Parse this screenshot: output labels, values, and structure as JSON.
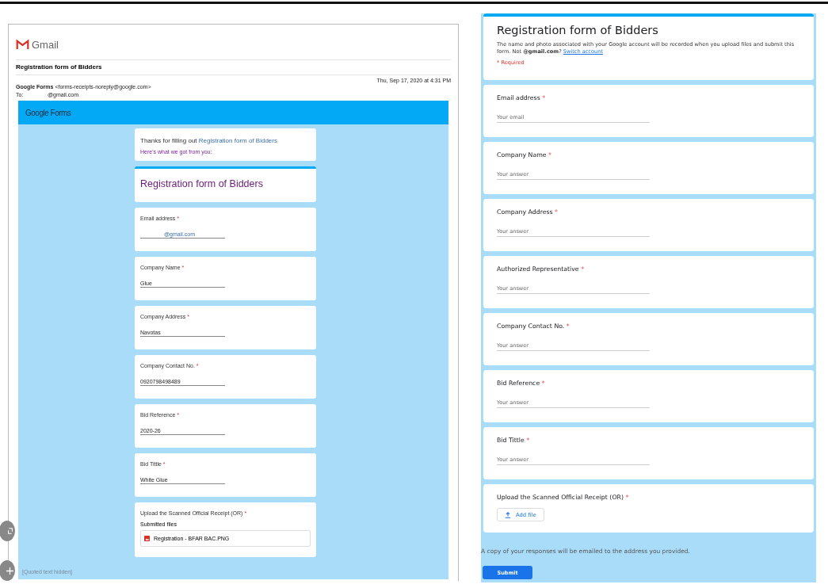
{
  "email": {
    "brand": "Gmail",
    "subject": "Registration form of Bidders",
    "sender_name": "Google Forms",
    "sender_address": "<forms-receipts-noreply@google.com>",
    "to_label": "To:",
    "to_address": "@gmail.com",
    "date": "Thu, Sep 17, 2020 at 4:31 PM",
    "banner": "Google Forms",
    "thanks_text": "Thanks for filling out",
    "thanks_link": "Registration form of Bidders",
    "thanks_sub": "Here's what we got from you:",
    "form_title": "Registration form of Bidders",
    "answers": [
      {
        "kind": "text",
        "label": "Email address",
        "asterisk": "*",
        "value": "@gmail.com"
      },
      {
        "kind": "text",
        "label": "Company Name",
        "asterisk": "*",
        "value": "Glue"
      },
      {
        "kind": "text",
        "label": "Company Address",
        "asterisk": "*",
        "value": "Navotas"
      },
      {
        "kind": "text",
        "label": "Company Contact No.",
        "asterisk": "*",
        "value": "0920798498489"
      },
      {
        "kind": "text",
        "label": "Bid Reference",
        "asterisk": "*",
        "value": "2020-26"
      },
      {
        "kind": "text",
        "label": "Bid Tittle",
        "asterisk": "*",
        "value": "White Glue"
      },
      {
        "kind": "file",
        "label": "Upload the Scanned Official Receipt (OR)",
        "asterisk": "*",
        "files_label": "Submitted files",
        "file": "Registration - BFAR BAC.PNG"
      }
    ],
    "quoted": "[Quoted text hidden]"
  },
  "form": {
    "title": "Registration form of Bidders",
    "notice": "The name and photo associated with your Google account will be recorded when you upload files and submit this form. Not **@gmail.com**?",
    "switch_link": "Switch account",
    "required_note": "* Required",
    "questions": [
      {
        "kind": "text",
        "label": "Email address",
        "asterisk": "*",
        "placeholder": "Your email"
      },
      {
        "kind": "text",
        "label": "Company Name",
        "asterisk": "*",
        "placeholder": "Your answer"
      },
      {
        "kind": "text",
        "label": "Company Address",
        "asterisk": "*",
        "placeholder": "Your answer"
      },
      {
        "kind": "text",
        "label": "Authorized Representative",
        "asterisk": "*",
        "placeholder": "Your answer"
      },
      {
        "kind": "text",
        "label": "Company Contact No.",
        "asterisk": "*",
        "placeholder": "Your answer"
      },
      {
        "kind": "text",
        "label": "Bid Reference",
        "asterisk": "*",
        "placeholder": "Your answer"
      },
      {
        "kind": "text",
        "label": "Bid Tittle",
        "asterisk": "*",
        "placeholder": "Your answer"
      },
      {
        "kind": "file",
        "label": "Upload the Scanned Official Receipt (OR)",
        "asterisk": "*",
        "button": "Add file"
      }
    ],
    "copy_note": "A copy of your responses will be emailed to the address you provided.",
    "submit": "Submit"
  }
}
